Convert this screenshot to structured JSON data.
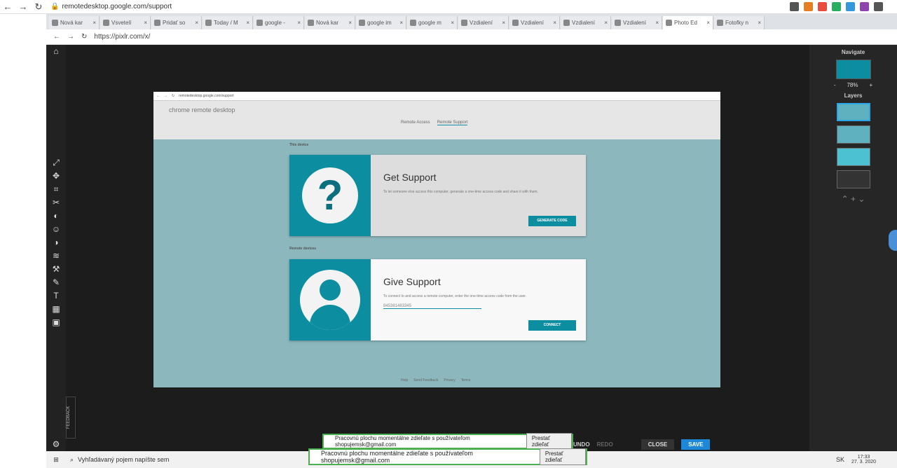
{
  "outer": {
    "url": "remotedesktop.google.com/support"
  },
  "tabs": [
    {
      "label": "Nová kar"
    },
    {
      "label": "Vsvetelí"
    },
    {
      "label": "Pridať so"
    },
    {
      "label": "Today / M"
    },
    {
      "label": "google -"
    },
    {
      "label": "Nová kar"
    },
    {
      "label": "google im"
    },
    {
      "label": "google m"
    },
    {
      "label": "Vzdialení"
    },
    {
      "label": "Vzdialení"
    },
    {
      "label": "Vzdialení"
    },
    {
      "label": "Vzdialení"
    },
    {
      "label": "Photo Ed"
    },
    {
      "label": "Fotofky n"
    }
  ],
  "inner": {
    "url": "https://pixlr.com/x/"
  },
  "navigate": {
    "title": "Navigate",
    "zoom": "78%",
    "minus": "-",
    "plus": "+"
  },
  "layers": {
    "title": "Layers"
  },
  "shot": {
    "url": "remotedesktop.google.com/support",
    "app_title": "chrome remote desktop",
    "tab_access": "Remote Access",
    "tab_support": "Remote Support",
    "this_device": "This device",
    "remote_devices": "Remote devices",
    "get": {
      "title": "Get Support",
      "desc": "To let someone else access this computer, generate a one-time access code and share it with them.",
      "btn": "GENERATE CODE"
    },
    "give": {
      "title": "Give Support",
      "desc": "To connect to and access a remote computer, enter the one-time access code from the user.",
      "code": "845381483345",
      "btn": "CONNECT"
    },
    "footer": [
      "Help",
      "Send Feedback",
      "Privacy",
      "Terms"
    ]
  },
  "banner": {
    "text": "Pracovnú plochu momentálne zdieľate s používateľom shopujemsk@gmail.com",
    "stop": "Prestať zdieľať"
  },
  "bottom": {
    "undo": "UNDO",
    "redo": "REDO",
    "close": "CLOSE",
    "save": "SAVE"
  },
  "feedback": "FEEDBACK",
  "taskbar": {
    "search": "Vyhľadávaný pojem napíšte sem",
    "lang": "SK",
    "time": "17:33",
    "date": "27. 3. 2020"
  }
}
